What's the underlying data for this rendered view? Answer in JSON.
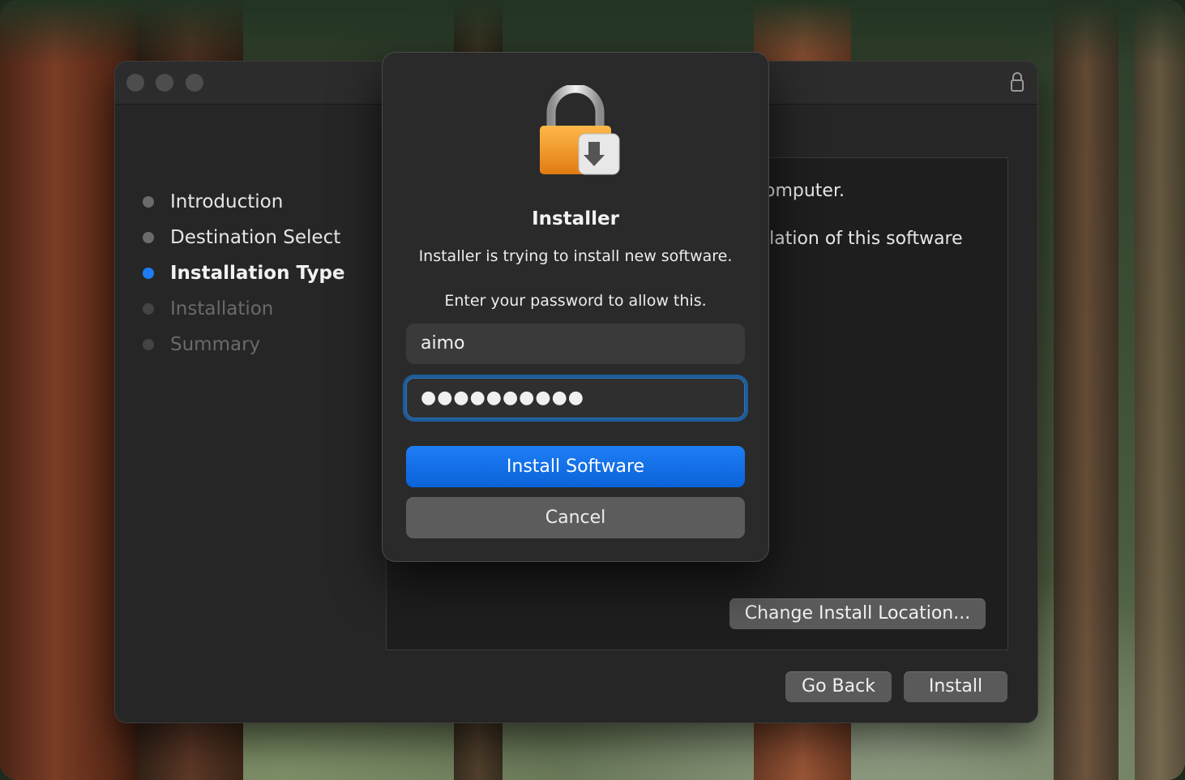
{
  "wallpaper": {
    "description_colors": [
      "#7a3c25",
      "#3a4a33"
    ]
  },
  "installer_window": {
    "steps": [
      {
        "label": "Introduction",
        "state": "done"
      },
      {
        "label": "Destination Select",
        "state": "done"
      },
      {
        "label": "Installation Type",
        "state": "active"
      },
      {
        "label": "Installation",
        "state": "future"
      },
      {
        "label": "Summary",
        "state": "future"
      }
    ],
    "content_line_1": "omputer.",
    "content_line_2": "llation of this software",
    "change_location_label": "Change Install Location...",
    "go_back_label": "Go Back",
    "install_label": "Install",
    "active_color": "#1e7bf2"
  },
  "auth_dialog": {
    "title": "Installer",
    "message": "Installer is trying to install new software.",
    "prompt": "Enter your password to allow this.",
    "username_value": "aimo",
    "password_value": "●●●●●●●●●●",
    "primary_button_label": "Install Software",
    "cancel_button_label": "Cancel",
    "primary_color": "#0a63d9"
  }
}
